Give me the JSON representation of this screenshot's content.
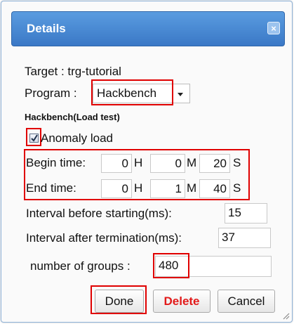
{
  "dialog": {
    "title": "Details",
    "close_label": "×"
  },
  "target": {
    "text": "Target : trg-tutorial"
  },
  "program": {
    "label": "Program :",
    "selected": "Hackbench"
  },
  "section": {
    "heading": "Hackbench(Load test)"
  },
  "anomaly": {
    "label": "Anomaly load",
    "checked": true
  },
  "begin_time": {
    "label": "Begin time:",
    "hours": "0",
    "h_unit": "H",
    "minutes": "0",
    "m_unit": "M",
    "seconds": "20",
    "s_unit": "S"
  },
  "end_time": {
    "label": "End time:",
    "hours": "0",
    "h_unit": "H",
    "minutes": "1",
    "m_unit": "M",
    "seconds": "40",
    "s_unit": "S"
  },
  "interval_before": {
    "label": "Interval before starting(ms):",
    "value": "15"
  },
  "interval_after": {
    "label": "Interval after termination(ms):",
    "value": "37"
  },
  "groups": {
    "label": "number of groups :",
    "value": "480"
  },
  "buttons": {
    "done": "Done",
    "delete": "Delete",
    "cancel": "Cancel"
  },
  "colors": {
    "titlebar": "#3a78c6",
    "highlight": "#e00000",
    "delete_text": "#e21a1a"
  },
  "icons": {
    "close": "close-icon",
    "dropdown": "chevron-down-icon",
    "check": "check-icon",
    "resize": "resize-grip-icon"
  }
}
